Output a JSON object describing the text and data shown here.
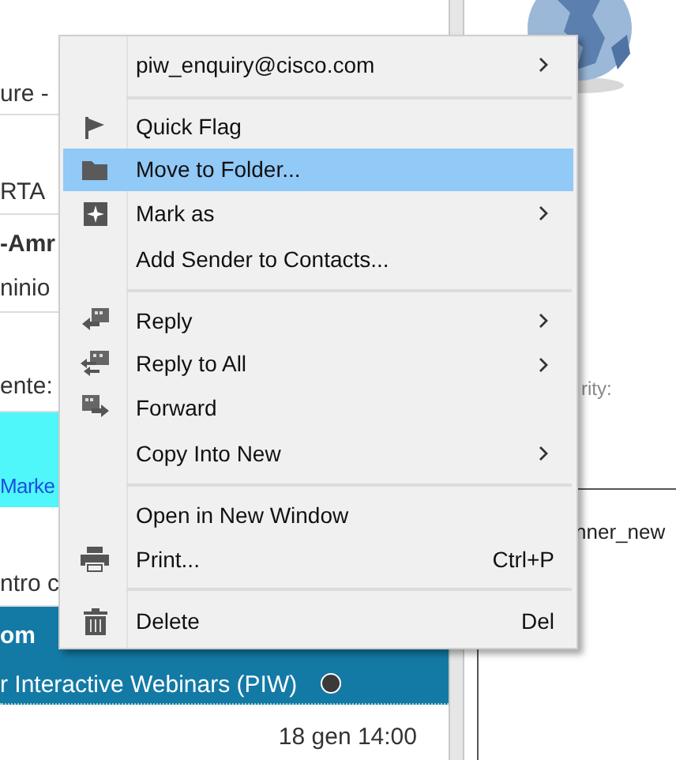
{
  "message_list": {
    "rows": [
      {
        "kind": "plain",
        "lines": [
          "ure -"
        ]
      },
      {
        "kind": "plain",
        "lines": [
          "RTA"
        ]
      },
      {
        "kind": "plain",
        "lines": [
          "-Amr",
          "ninio"
        ],
        "bold_first": true
      },
      {
        "kind": "plain",
        "lines": [
          "ente: "
        ]
      },
      {
        "kind": "cyan",
        "lines": [
          "Marke"
        ]
      },
      {
        "kind": "plain",
        "lines": [
          "ntro c"
        ]
      },
      {
        "kind": "selected",
        "lines": [
          "om",
          "r Interactive Webinars (PIW)"
        ]
      },
      {
        "kind": "date",
        "lines": [
          "18 gen 14:00"
        ]
      }
    ]
  },
  "preview": {
    "texts": [
      "rity:",
      "nner_new"
    ]
  },
  "context_menu": {
    "items": [
      {
        "kind": "item",
        "label": "piw_enquiry@cisco.com",
        "submenu": true,
        "selected": false
      },
      {
        "kind": "separator"
      },
      {
        "kind": "item",
        "label": "Quick Flag",
        "submenu": false,
        "selected": false
      },
      {
        "kind": "item",
        "label": "Move to Folder...",
        "submenu": false,
        "selected": true
      },
      {
        "kind": "item",
        "label": "Mark as",
        "submenu": true,
        "selected": false
      },
      {
        "kind": "item",
        "label": "Add Sender to Contacts...",
        "submenu": false,
        "selected": false
      },
      {
        "kind": "separator"
      },
      {
        "kind": "item",
        "label": "Reply",
        "submenu": true,
        "selected": false
      },
      {
        "kind": "item",
        "label": "Reply to All",
        "submenu": true,
        "selected": false
      },
      {
        "kind": "item",
        "label": "Forward",
        "submenu": false,
        "selected": false
      },
      {
        "kind": "item",
        "label": "Copy Into New",
        "submenu": true,
        "selected": false
      },
      {
        "kind": "separator"
      },
      {
        "kind": "item",
        "label": "Open in New Window",
        "submenu": false,
        "selected": false
      },
      {
        "kind": "item",
        "label": "Print...",
        "shortcut": "Ctrl+P",
        "submenu": false,
        "selected": false
      },
      {
        "kind": "separator"
      },
      {
        "kind": "item",
        "label": "Delete",
        "shortcut": "Del",
        "submenu": false,
        "selected": false
      }
    ]
  }
}
